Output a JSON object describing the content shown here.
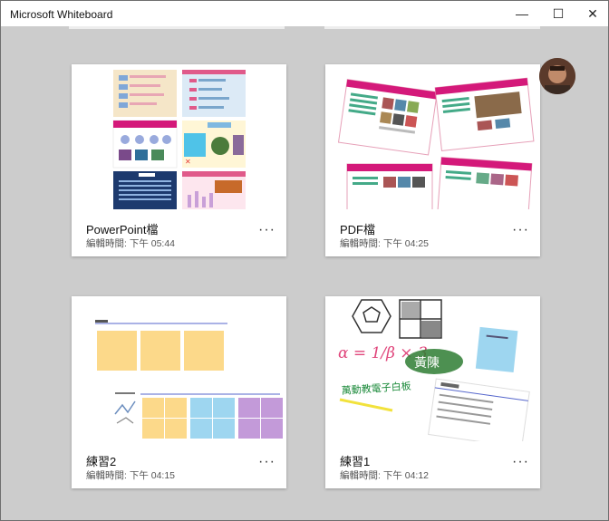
{
  "window": {
    "title": "Microsoft Whiteboard"
  },
  "controls": {
    "minimize": "—",
    "maximize": "☐",
    "close": "✕"
  },
  "colors": {
    "background": "#cccccc",
    "card": "#ffffff",
    "accent_pink": "#d4197a",
    "sticky_yellow": "#fcd98a",
    "sticky_blue": "#9ed6f0",
    "sticky_purple": "#c39ad9"
  },
  "user": {
    "avatar": "avatar-icon"
  },
  "boards": [
    {
      "name": "PowerPoint檔",
      "edited": "編輯時間: 下午 05:44",
      "more": "···"
    },
    {
      "name": "PDF檔",
      "edited": "編輯時間: 下午 04:25",
      "more": "···"
    },
    {
      "name": "練習2",
      "edited": "編輯時間: 下午 04:15",
      "more": "···"
    },
    {
      "name": "練習1",
      "edited": "編輯時間: 下午 04:12",
      "more": "···"
    }
  ],
  "thumb_text": {
    "ink_formula": "α = 1/β × 3",
    "name_chars": "黃陳",
    "green_handwriting": "萬動教電子白板"
  }
}
